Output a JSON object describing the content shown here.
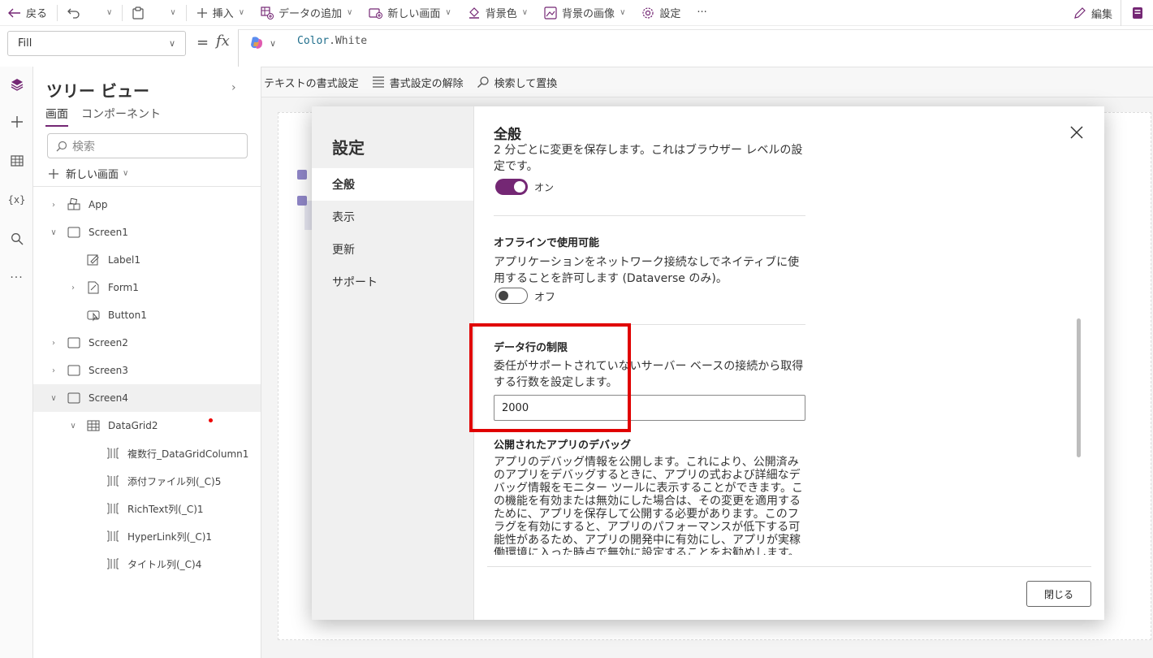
{
  "toolbar": {
    "back": "戻る",
    "insert": "挿入",
    "add_data": "データの追加",
    "new_screen": "新しい画面",
    "background_color": "背景色",
    "background_image": "背景の画像",
    "settings": "設定",
    "more": "···",
    "edit": "編集"
  },
  "formula": {
    "property": "Fill",
    "equals": "=",
    "fx": "fx",
    "expression_object": "Color",
    "expression_member": ".White"
  },
  "format_bar": {
    "format_text": "テキストの書式設定",
    "remove_format": "書式設定の解除",
    "find_replace": "検索して置換"
  },
  "tree": {
    "title": "ツリー ビュー",
    "tabs": [
      "画面",
      "コンポーネント"
    ],
    "search_placeholder": "検索",
    "new_screen": "新しい画面",
    "nodes": [
      {
        "label": "App"
      },
      {
        "label": "Screen1"
      },
      {
        "label": "Label1"
      },
      {
        "label": "Form1"
      },
      {
        "label": "Button1"
      },
      {
        "label": "Screen2"
      },
      {
        "label": "Screen3"
      },
      {
        "label": "Screen4"
      },
      {
        "label": "DataGrid2"
      },
      {
        "label": "複数行_DataGridColumn1"
      },
      {
        "label": "添付ファイル列(_C)5"
      },
      {
        "label": "RichText列(_C)1"
      },
      {
        "label": "HyperLink列(_C)1"
      },
      {
        "label": "タイトル列(_C)4"
      }
    ]
  },
  "dialog": {
    "title": "設定",
    "nav": [
      "全般",
      "表示",
      "更新",
      "サポート"
    ],
    "section_heading": "全般",
    "autosave_desc": "2 分ごとに変更を保存します。これはブラウザー レベルの設定です。",
    "autosave_state": "オン",
    "offline_title": "オフラインで使用可能",
    "offline_desc": "アプリケーションをネットワーク接続なしでネイティブに使用することを許可します (Dataverse のみ)。",
    "offline_state": "オフ",
    "row_limit_title": "データ行の制限",
    "row_limit_desc": "委任がサポートされていないサーバー ベースの接続から取得する行数を設定します。",
    "row_limit_value": "2000",
    "debug_title": "公開されたアプリのデバッグ",
    "debug_desc": "アプリのデバッグ情報を公開します。これにより、公開済みのアプリをデバッグするときに、アプリの式および詳細なデバッグ情報をモニター ツールに表示することができます。この機能を有効または無効にした場合は、その変更を適用するために、アプリを保存して公開する必要があります。このフラグを有効にすると、アプリのパフォーマンスが低下する可能性があるため、アプリの開発中に有効にし、アプリが実稼働環境に入った時点で無効に設定することをお勧めします。",
    "close_button": "閉じる"
  },
  "colors": {
    "accent": "#742774",
    "highlight": "#e00000",
    "checkbox": "#8f86c7"
  }
}
